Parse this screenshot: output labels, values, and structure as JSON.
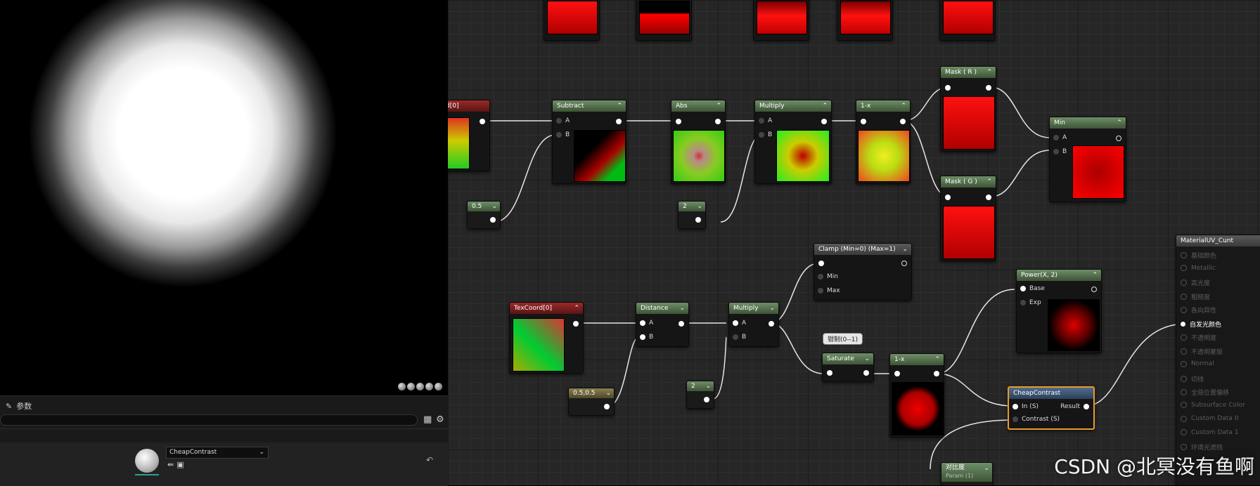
{
  "params_panel": {
    "tab_label": "参数",
    "asset_name": "CheapContrast"
  },
  "nodes": {
    "texcoord_top": "d[0]",
    "subtract": {
      "title": "Subtract",
      "a": "A",
      "b": "B"
    },
    "abs": {
      "title": "Abs"
    },
    "multiply_top": {
      "title": "Multiply",
      "a": "A",
      "b": "B"
    },
    "one_minus_top": {
      "title": "1-x"
    },
    "mask_r": {
      "title": "Mask ( R )"
    },
    "mask_g": {
      "title": "Mask ( G )"
    },
    "min": {
      "title": "Min",
      "a": "A",
      "b": "B"
    },
    "const_05": "0.5",
    "const_2_top": "2",
    "clamp": {
      "title": "Clamp (Min=0) (Max=1)",
      "min": "Min",
      "max": "Max"
    },
    "texcoord": {
      "title": "TexCoord[0]"
    },
    "distance": {
      "title": "Distance",
      "a": "A",
      "b": "B"
    },
    "multiply_bottom": {
      "title": "Multiply",
      "a": "A",
      "b": "B"
    },
    "const_0505": "0.5,0.5",
    "const_2_bottom": "2",
    "comment_clamp": "钳制(0--1)",
    "saturate": {
      "title": "Saturate"
    },
    "one_minus_bottom": {
      "title": "1-x"
    },
    "power": {
      "title": "Power(X, 2)",
      "base": "Base",
      "exp": "Exp"
    },
    "cheap_contrast": {
      "title": "CheapContrast",
      "in": "In (S)",
      "contrast": "Contrast (S)",
      "result": "Result"
    },
    "param_contrast": {
      "title": "对比度",
      "subtitle": "Param (1)"
    },
    "material": {
      "title": "MaterialUV_Cunt",
      "inputs": [
        "基础颜色",
        "Metallic",
        "高光度",
        "粗糙度",
        "各向异性",
        "自发光颜色",
        "不透明度",
        "不透明蒙版",
        "Normal",
        "切线",
        "全局位置偏移",
        "Subsurface Color",
        "Custom Data 0",
        "Custom Data 1",
        "环境光遮挡"
      ],
      "active_input": "自发光颜色"
    }
  },
  "watermark": "CSDN @北冥没有鱼啊"
}
